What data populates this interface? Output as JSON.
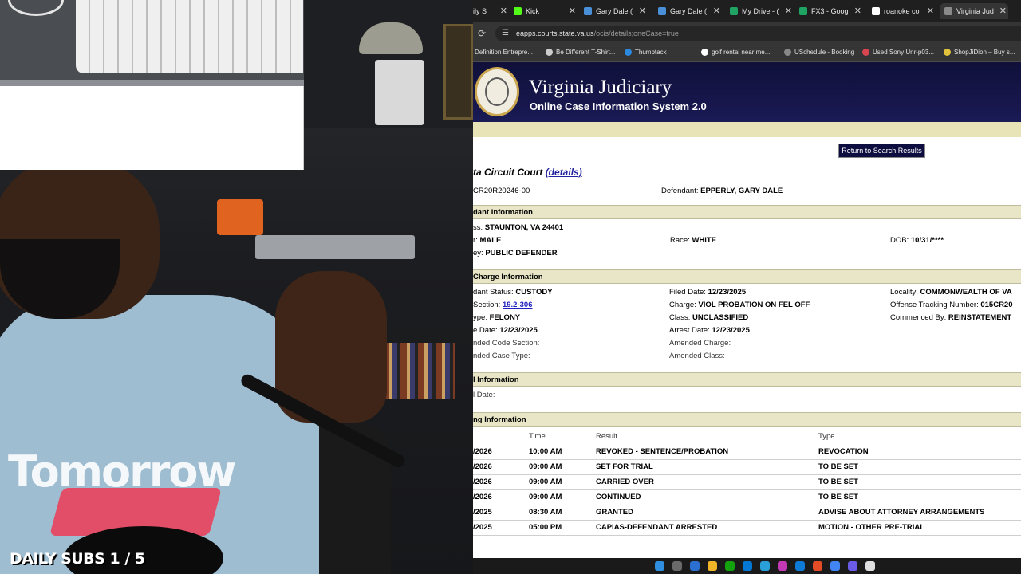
{
  "overlay": {
    "label": "DAILY SUBS 1 / 5"
  },
  "webcam": {
    "shirt_print": "Tomorrow"
  },
  "browser": {
    "tabs": [
      {
        "label": "ily S",
        "color": "#8a8a8a"
      },
      {
        "label": "Kick",
        "color": "#53fc18"
      },
      {
        "label": "Gary Dale (",
        "color": "#4a90d9"
      },
      {
        "label": "Gary Dale (",
        "color": "#4a90d9"
      },
      {
        "label": "My Drive - (",
        "color": "#1fa463"
      },
      {
        "label": "FX3 - Goog",
        "color": "#1fa463"
      },
      {
        "label": "roanoke co",
        "color": "#ffffff"
      },
      {
        "label": "Virginia Jud",
        "color": "#8a8a8a"
      }
    ],
    "url_host": "eapps.courts.state.va.us",
    "url_path": "/ocis/details;oneCase=true",
    "bookmarks": [
      {
        "label": "Definition Entrepre...",
        "color": "#888888"
      },
      {
        "label": "Be Different T-Shirt...",
        "color": "#cccccc"
      },
      {
        "label": "Thumbtack",
        "color": "#2b8ae0"
      },
      {
        "label": "golf rental near me...",
        "color": "#ffffff"
      },
      {
        "label": "USchedule - Booking",
        "color": "#888888"
      },
      {
        "label": "Used Sony Unr-p03...",
        "color": "#d64550"
      },
      {
        "label": "ShopJiDion – Buy s...",
        "color": "#e2c23b"
      }
    ]
  },
  "page": {
    "title": "Virginia Judiciary",
    "subtitle": "Online Case Information System 2.0",
    "return_button": "Return to Search Results",
    "court_name": "ta Circuit Court",
    "details_link": "(details)",
    "case_number": "CR20R20246-00",
    "defendant_label": "Defendant:",
    "defendant_value": "EPPERLY, GARY DALE",
    "defendant_section": "dant Information",
    "address_label": "ss:",
    "address_value": "STAUNTON, VA 24401",
    "gender_label": "r:",
    "gender_value": "MALE",
    "race_label": "Race:",
    "race_value": "WHITE",
    "dob_label": "DOB:",
    "dob_value": "10/31/****",
    "attorney_label": "ey:",
    "attorney_value": "PUBLIC DEFENDER",
    "charge_section": "Charge Information",
    "status_label": "dant Status:",
    "status_value": "CUSTODY",
    "filed_label": "Filed Date:",
    "filed_value": "12/23/2025",
    "locality_label": "Locality:",
    "locality_value": "COMMONWEALTH OF VA",
    "code_label": "Section:",
    "code_value": "19.2-306",
    "charge_label": "Charge:",
    "charge_value": "VIOL PROBATION ON FEL OFF",
    "otn_label": "Offense Tracking Number:",
    "otn_value": "015CR20",
    "type_label": "ype:",
    "type_value": "FELONY",
    "class_label": "Class:",
    "class_value": "UNCLASSIFIED",
    "commenced_label": "Commenced By:",
    "commenced_value": "REINSTATEMENT",
    "offense_label": "e Date:",
    "offense_value": "12/23/2025",
    "arrest_label": "Arrest Date:",
    "arrest_value": "12/23/2025",
    "amended_code_label": "nded Code Section:",
    "amended_charge_label": "Amended Charge:",
    "amended_type_label": "nded Case Type:",
    "amended_class_label": "Amended Class:",
    "appeal_section": "l Information",
    "appeal_date_label": "l Date:",
    "hearing_section": "ng Information",
    "hearing_headers": {
      "time": "Time",
      "result": "Result",
      "type": "Type"
    },
    "hearings": [
      {
        "date": "/2026",
        "time": "10:00 AM",
        "result": "REVOKED - SENTENCE/PROBATION",
        "type": "REVOCATION"
      },
      {
        "date": "/2026",
        "time": "09:00 AM",
        "result": "SET FOR TRIAL",
        "type": "TO BE SET"
      },
      {
        "date": "/2026",
        "time": "09:00 AM",
        "result": "CARRIED OVER",
        "type": "TO BE SET"
      },
      {
        "date": "/2026",
        "time": "09:00 AM",
        "result": "CONTINUED",
        "type": "TO BE SET"
      },
      {
        "date": "/2025",
        "time": "08:30 AM",
        "result": "GRANTED",
        "type": "ADVISE ABOUT ATTORNEY ARRANGEMENTS"
      },
      {
        "date": "/2025",
        "time": "05:00 PM",
        "result": "CAPIAS-DEFENDANT ARRESTED",
        "type": "MOTION - OTHER PRE-TRIAL"
      }
    ]
  }
}
